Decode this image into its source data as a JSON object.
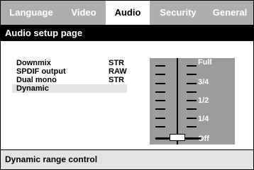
{
  "tabs": [
    {
      "label": "Language",
      "active": false
    },
    {
      "label": "Video",
      "active": false
    },
    {
      "label": "Audio",
      "active": true
    },
    {
      "label": "Security",
      "active": false
    },
    {
      "label": "General",
      "active": false
    }
  ],
  "page_title": "Audio setup page",
  "settings": [
    {
      "label": "Downmix",
      "value": "STR"
    },
    {
      "label": "SPDIF output",
      "value": "RAW"
    },
    {
      "label": "Dual mono",
      "value": "STR"
    },
    {
      "label": "Dynamic",
      "value": "",
      "selected": true
    }
  ],
  "dynamic_slider": {
    "levels": [
      "Full",
      "3/4",
      "1/2",
      "1/4",
      "Off"
    ],
    "current_level": "Off"
  },
  "status_text": "Dynamic range control",
  "colors": {
    "tabbar_bg": "#aeaeae",
    "tab_active_bg": "#ffffff",
    "title_bar_bg": "#000000",
    "selected_row_bg": "#e3e3e3",
    "slider_bg": "#9c9c9c",
    "status_bg": "#e3e3e3"
  }
}
